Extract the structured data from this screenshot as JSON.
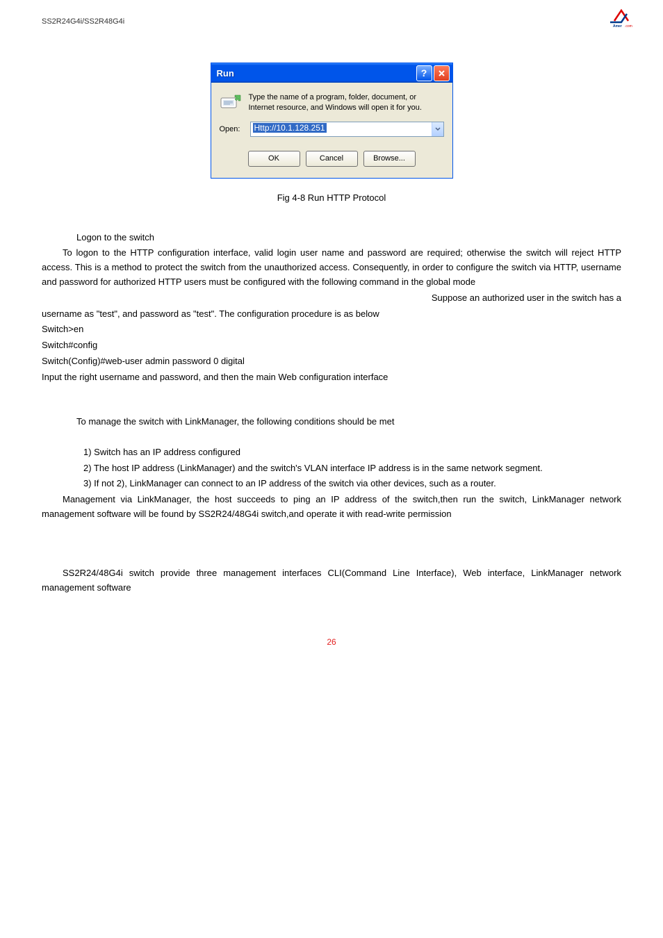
{
  "header": {
    "model": "SS2R24G4i/SS2R48G4i"
  },
  "dialog": {
    "title": "Run",
    "description": "Type the name of a program, folder, document, or Internet resource, and Windows will open it for you.",
    "open_label": "Open:",
    "open_value": "Http://10.1.128.251",
    "ok": "OK",
    "cancel": "Cancel",
    "browse": "Browse..."
  },
  "caption": "Fig 4-8 Run HTTP Protocol",
  "body": {
    "logon_header": "Logon to the switch",
    "para1": "To logon to the HTTP configuration interface, valid login user name and password are required; otherwise the switch will reject HTTP access. This is a method to protect the switch from the unauthorized access. Consequently, in order to configure the switch via HTTP, username and password for authorized HTTP users must be configured with the following command in the global mode",
    "para1b": "Suppose an authorized user in the switch has a",
    "para2": "username as \"test\", and password as \"test\". The configuration procedure is as below",
    "cmd1": "Switch>en",
    "cmd2": "Switch#config",
    "cmd3": "Switch(Config)#web-user admin password 0 digital",
    "para3": "Input the right username and password, and then the main Web configuration interface",
    "para4": "To manage the switch with LinkManager, the following conditions should be met",
    "li1": "1)   Switch has an IP address configured",
    "li2": "2)   The host IP address (LinkManager) and the switch's VLAN interface IP address is in the same network segment.",
    "li3": "3)   If not 2), LinkManager can connect to an IP address of the switch via other devices, such as a router.",
    "para5": "Management via LinkManager, the host succeeds to ping an IP address of the switch,then run the switch, LinkManager network management software will be found by SS2R24/48G4i switch,and operate it with read-write permission",
    "para6": "SS2R24/48G4i switch provide three management interfaces    CLI(Command Line Interface), Web interface, LinkManager network management software"
  },
  "page_num": "26"
}
